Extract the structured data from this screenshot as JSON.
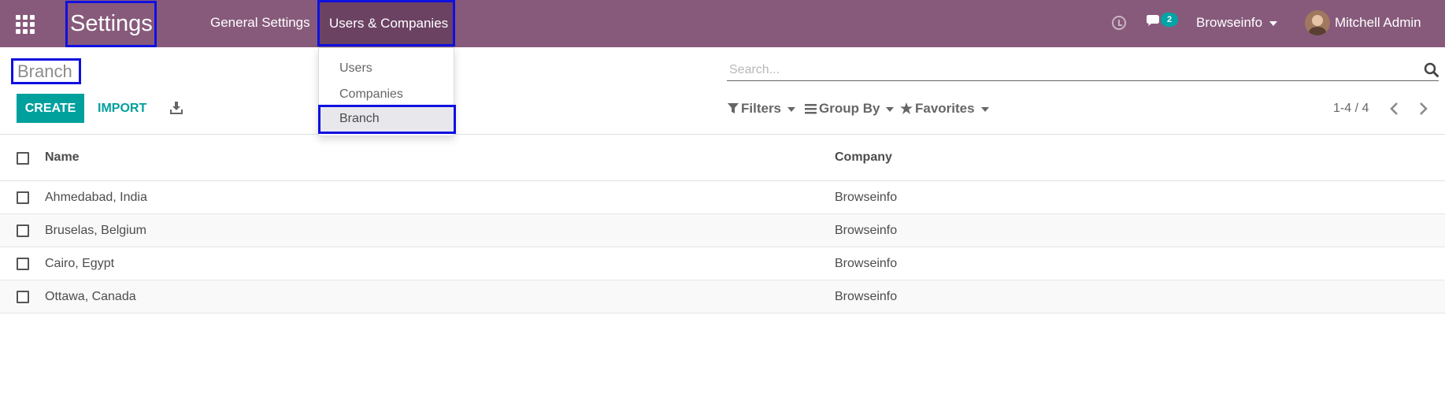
{
  "navbar": {
    "app_title": "Settings",
    "menus": {
      "general": "General Settings",
      "users_companies": "Users & Companies"
    },
    "chat_count": "2",
    "company": "Browseinfo",
    "user": "Mitchell Admin"
  },
  "dropdown": {
    "items": [
      "Users",
      "Companies",
      "Branch"
    ],
    "active": "Branch"
  },
  "control_panel": {
    "title": "Branch",
    "search_placeholder": "Search...",
    "create_label": "CREATE",
    "import_label": "IMPORT",
    "filters_label": "Filters",
    "groupby_label": "Group By",
    "favorites_label": "Favorites",
    "pager": "1-4 / 4"
  },
  "list": {
    "columns": {
      "name": "Name",
      "company": "Company"
    },
    "rows": [
      {
        "name": "Ahmedabad, India",
        "company": "Browseinfo"
      },
      {
        "name": "Bruselas, Belgium",
        "company": "Browseinfo"
      },
      {
        "name": "Cairo, Egypt",
        "company": "Browseinfo"
      },
      {
        "name": "Ottawa, Canada",
        "company": "Browseinfo"
      }
    ]
  },
  "colors": {
    "navbar": "#875a7b",
    "accent": "#00a09d",
    "highlight": "#1010e0",
    "badge": "#01a4a4"
  }
}
